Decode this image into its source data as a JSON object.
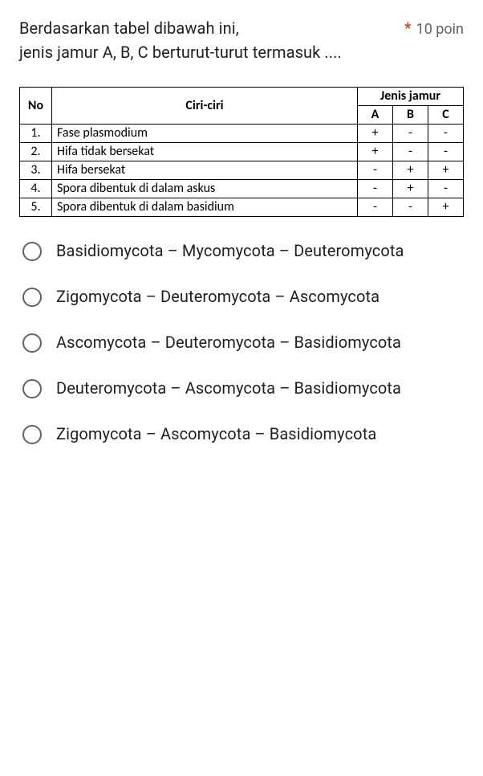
{
  "question": {
    "line1": "Berdasarkan tabel dibawah ini,",
    "line2": "jenis jamur A, B, C berturut-turut termasuk ....",
    "required_mark": "*",
    "points": "10 poin"
  },
  "table": {
    "head": {
      "no": "No",
      "ciri": "Ciri-ciri",
      "jenis": "Jenis jamur",
      "a": "A",
      "b": "B",
      "c": "C"
    },
    "rows": [
      {
        "no": "1.",
        "ciri": "Fase plasmodium",
        "a": "+",
        "b": "-",
        "c": "-"
      },
      {
        "no": "2.",
        "ciri": "Hifa tidak bersekat",
        "a": "+",
        "b": "-",
        "c": "-"
      },
      {
        "no": "3.",
        "ciri": "Hifa bersekat",
        "a": "-",
        "b": "+",
        "c": "+"
      },
      {
        "no": "4.",
        "ciri": "Spora dibentuk di dalam askus",
        "a": "-",
        "b": "+",
        "c": "-"
      },
      {
        "no": "5.",
        "ciri": "Spora dibentuk di dalam basidium",
        "a": "-",
        "b": "-",
        "c": "+"
      }
    ]
  },
  "options": [
    "Basidiomycota – Mycomycota – Deuteromycota",
    "Zigomycota – Deuteromycota – Ascomycota",
    "Ascomycota – Deuteromycota – Basidiomycota",
    "Deuteromycota – Ascomycota – Basidiomycota",
    "Zigomycota – Ascomycota – Basidiomycota"
  ]
}
